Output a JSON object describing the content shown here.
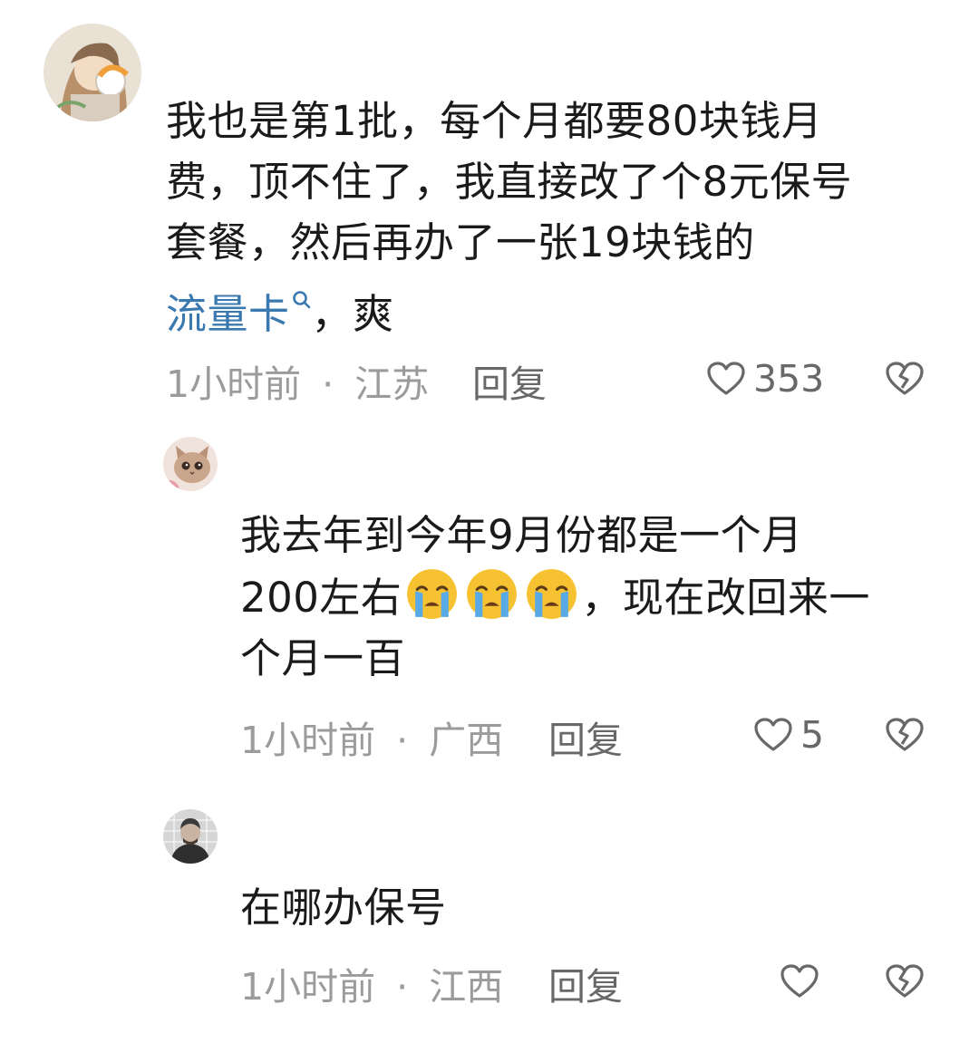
{
  "comments": [
    {
      "avatar_icon": "user-avatar-anime-girl-with-headphones",
      "text_lines": [
        "我也是第1批，每个月都要80块钱月",
        "费，顶不住了，我直接改了个8元保号",
        "套餐，然后再办了一张19块钱的"
      ],
      "link_text": "流量卡",
      "link_icon": "search-icon",
      "tail_text": "，爽",
      "time": "1小时前",
      "separator": "·",
      "location": "江苏",
      "reply_label": "回复",
      "likes": "353"
    },
    {
      "avatar_icon": "user-avatar-cat",
      "line1": "我去年到今年9月份都是一个月",
      "line2_prefix": "200左右",
      "emojis": [
        "crying-face-emoji",
        "crying-face-emoji",
        "crying-face-emoji"
      ],
      "line2_suffix": "，现在改回来一",
      "line3": "个月一百",
      "time": "1小时前",
      "separator": "·",
      "location": "广西",
      "reply_label": "回复",
      "likes": "5"
    },
    {
      "avatar_icon": "user-avatar-hooded-man",
      "text": "在哪办保号",
      "time": "1小时前",
      "separator": "·",
      "location": "江西",
      "reply_label": "回复",
      "likes": ""
    }
  ],
  "colors": {
    "link": "#3a78b0",
    "meta": "#9b9b9b",
    "action": "#686868",
    "text": "#1a1a1a"
  }
}
